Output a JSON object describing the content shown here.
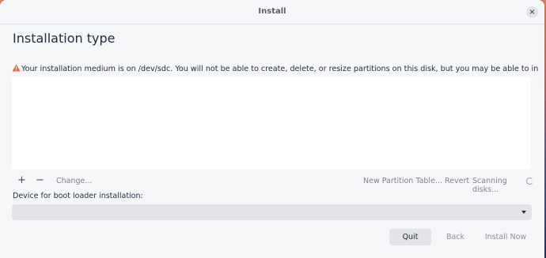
{
  "window": {
    "title": "Install",
    "close_symbol": "×"
  },
  "page": {
    "title": "Installation type"
  },
  "warning": {
    "icon": "warning-triangle-icon",
    "text": "Your installation medium is on /dev/sdc. You will not be able to create, delete, or resize partitions on this disk, but you may be able to install to existing partitions there."
  },
  "toolbar": {
    "add_label": "+",
    "remove_label": "−",
    "change_label": "Change...",
    "new_table_label": "New Partition Table...",
    "revert_label": "Revert",
    "scanning_label": "Scanning disks..."
  },
  "boot_loader": {
    "label": "Device for boot loader installation:",
    "value": ""
  },
  "buttons": {
    "quit": "Quit",
    "back": "Back",
    "install_now": "Install Now"
  },
  "colors": {
    "accent_warning": "#e8693f",
    "window_bg": "#f6f7f9",
    "button_bg": "#e3e4e8"
  }
}
